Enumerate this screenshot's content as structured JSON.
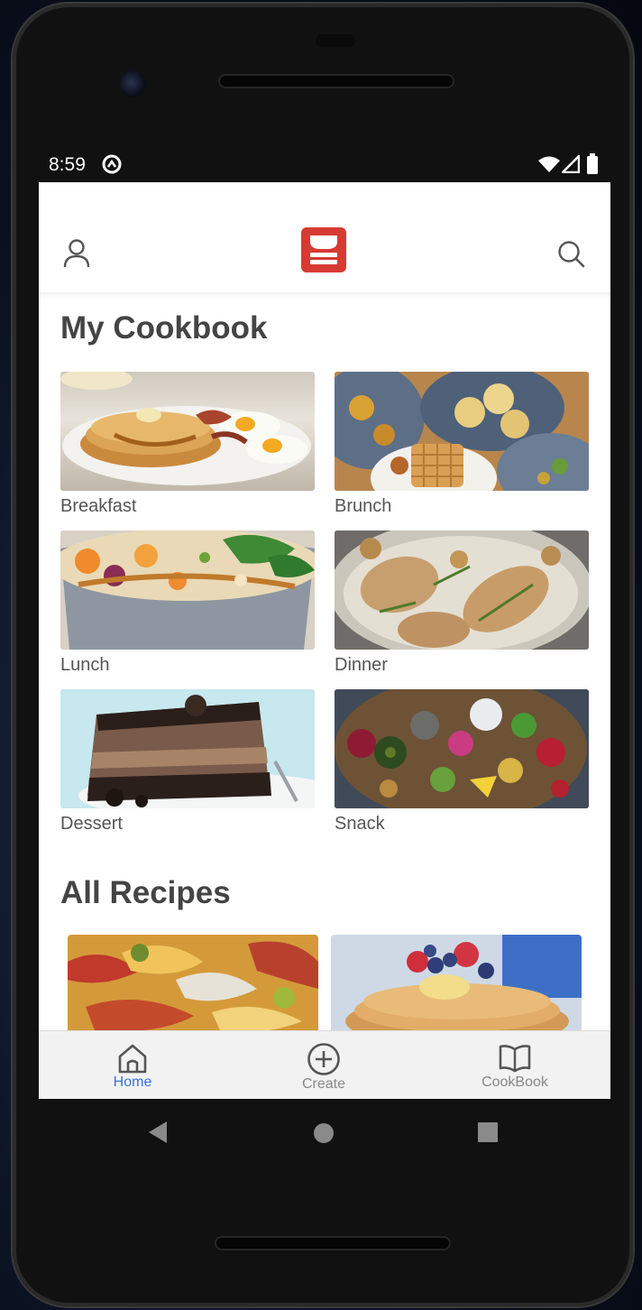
{
  "status": {
    "time": "8:59"
  },
  "header": {
    "profile_icon": "user-icon",
    "logo_icon": "cookbook-logo-icon",
    "search_icon": "search-icon",
    "brand_color": "#d63a33"
  },
  "my_cookbook": {
    "title": "My Cookbook",
    "categories": [
      {
        "label": "Breakfast",
        "image": "pancakes-eggs-bacon"
      },
      {
        "label": "Brunch",
        "image": "waffles-plates"
      },
      {
        "label": "Lunch",
        "image": "salad-bowl"
      },
      {
        "label": "Dinner",
        "image": "chicken-skillet"
      },
      {
        "label": "Dessert",
        "image": "oreo-cake"
      },
      {
        "label": "Snack",
        "image": "charcuterie-board"
      }
    ]
  },
  "all_recipes": {
    "title": "All Recipes",
    "items": [
      {
        "image": "pasta-dish"
      },
      {
        "image": "pancakes-berries"
      }
    ]
  },
  "bottom_nav": {
    "items": [
      {
        "label": "Home",
        "icon": "home-icon",
        "active": true
      },
      {
        "label": "Create",
        "icon": "plus-circle-icon",
        "active": false
      },
      {
        "label": "CookBook",
        "icon": "book-icon",
        "active": false
      }
    ],
    "active_color": "#3a72d6"
  },
  "system_nav": {
    "back": "back-icon",
    "home": "home-circle-icon",
    "recents": "recents-icon"
  }
}
